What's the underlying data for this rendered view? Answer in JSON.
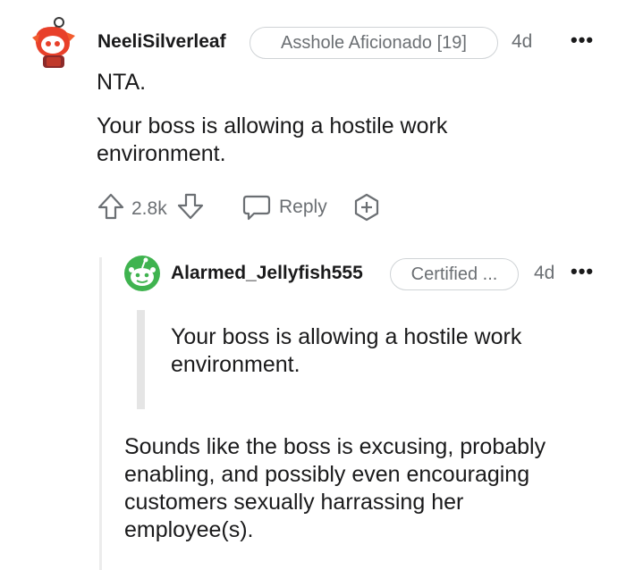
{
  "comment": {
    "username": "NeeliSilverleaf",
    "flair": "Asshole Aficionado [19]",
    "time": "4d",
    "more": "•••",
    "paragraphs": [
      "NTA.",
      "Your boss is allowing a hostile work environment."
    ],
    "votes": "2.8k",
    "reply_label": "Reply"
  },
  "reply": {
    "username": "Alarmed_Jellyfish555",
    "flair": "Certified ...",
    "time": "4d",
    "more": "•••",
    "quote": "Your boss is allowing a hostile work environment.",
    "body": "Sounds like the boss is excusing, probably enabling, and possibly even encouraging customers sexually harrassing her employee(s)."
  },
  "colors": {
    "meta": "#6b6f73",
    "text": "#1a1a1b",
    "snoo_green": "#3fb34f",
    "snoo_red": "#e8402a"
  }
}
